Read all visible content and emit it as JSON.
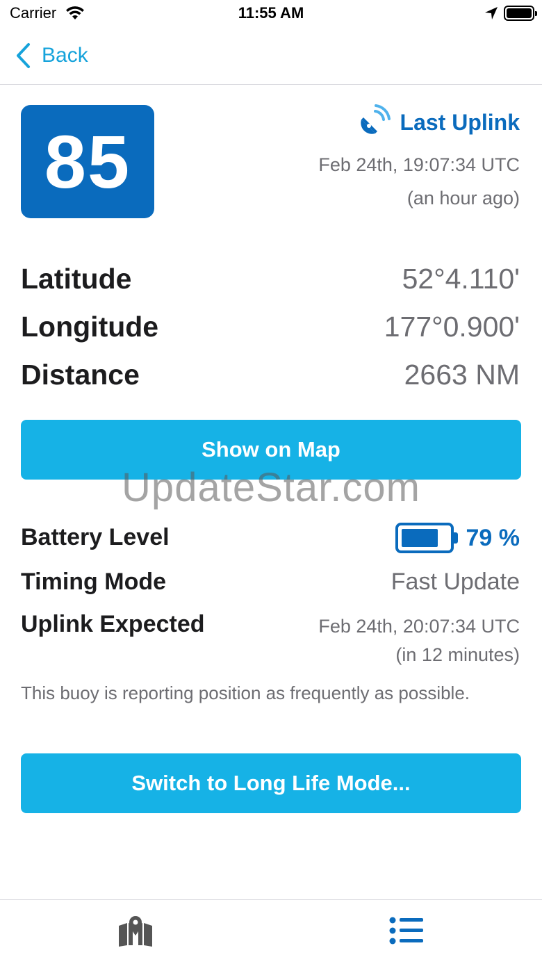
{
  "status_bar": {
    "carrier": "Carrier",
    "time": "11:55 AM"
  },
  "nav": {
    "back_label": "Back"
  },
  "buoy": {
    "number": "85"
  },
  "last_uplink": {
    "title": "Last Uplink",
    "date": "Feb 24th, 19:07:34 UTC",
    "relative": "(an hour ago)"
  },
  "position": {
    "latitude_label": "Latitude",
    "latitude_value": "52°4.110'",
    "longitude_label": "Longitude",
    "longitude_value": "177°0.900'",
    "distance_label": "Distance",
    "distance_value": "2663 NM"
  },
  "buttons": {
    "show_on_map": "Show on Map",
    "switch_mode": "Switch to Long Life Mode..."
  },
  "watermark": "UpdateStar.com",
  "status": {
    "battery_label": "Battery Level",
    "battery_value": "79 %",
    "battery_fraction": 0.79,
    "timing_label": "Timing Mode",
    "timing_value": "Fast Update",
    "expected_label": "Uplink Expected",
    "expected_date": "Feb 24th, 20:07:34 UTC",
    "expected_relative": "(in 12 minutes)",
    "note": "This buoy is reporting position as frequently as possible."
  },
  "colors": {
    "accent": "#16b2e6",
    "brand_blue": "#0a6bbd",
    "back_blue": "#16a3db",
    "secondary_text": "#6d6d72"
  },
  "icons": {
    "wifi": "wifi-icon",
    "location": "location-arrow-icon",
    "battery": "battery-icon",
    "satellite": "satellite-dish-icon",
    "map_tab": "map-pin-icon",
    "list_tab": "list-icon"
  }
}
